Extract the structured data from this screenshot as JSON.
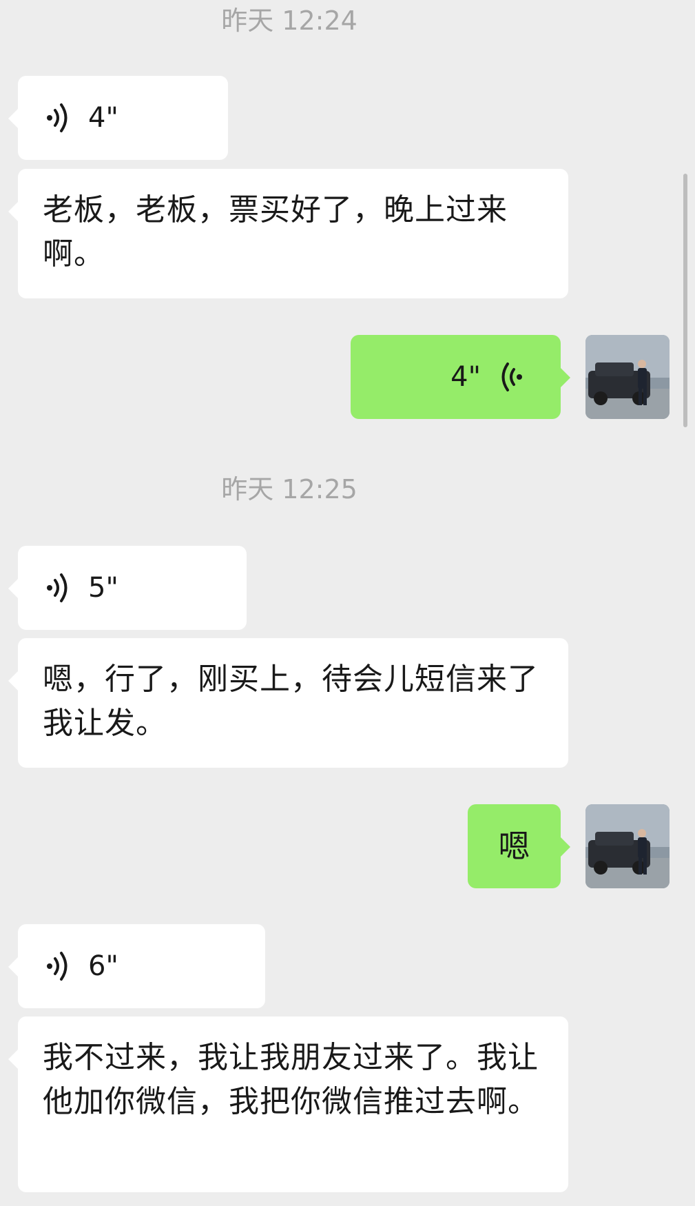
{
  "messages": {
    "ts1": "昨天 12:24",
    "v1": "4\"",
    "t1": "老板，老板，票买好了，晚上过来啊。",
    "v2": "4\"",
    "ts2": "昨天 12:25",
    "v3": "5\"",
    "t2": "嗯，行了，刚买上，待会儿短信来了我让发。",
    "t3": "嗯",
    "v4": "6\"",
    "t4": "我不过来，我让我朋友过来了。我让他加你微信，我把你微信推过去啊。"
  },
  "icons": {
    "voice_in": "voice-wave-icon",
    "voice_out": "voice-wave-icon",
    "avatar": "avatar-photo"
  },
  "colors": {
    "background": "#ededed",
    "incoming": "#ffffff",
    "outgoing": "#95ec69",
    "timestamp": "#a6a6a6"
  }
}
